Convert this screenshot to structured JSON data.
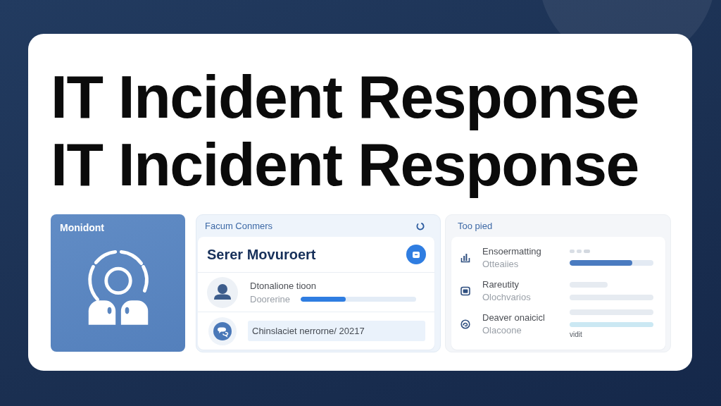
{
  "headline": [
    "IT Incident Response",
    "IT Incident Response"
  ],
  "left_panel": {
    "label": "Monidont"
  },
  "center_panel": {
    "header": "Facum Conmers",
    "title": "Serer Movuroert",
    "rows": [
      {
        "kind": "progress",
        "name": "Dtonalione tioon",
        "sub": "Doorerine",
        "level": 0.39
      },
      {
        "kind": "field",
        "value": "Chinslaciet nerrorne/ 20217"
      }
    ]
  },
  "right_panel": {
    "header": "Too pied",
    "rows": [
      {
        "name": "Ensoermatting",
        "sub": "Otteaiies",
        "aside": [
          {
            "kind": "dots"
          },
          {
            "kind": "meter",
            "level": 0.75
          }
        ]
      },
      {
        "name": "Rareutity",
        "sub": "Olochvarios",
        "aside": [
          {
            "kind": "stub"
          },
          {
            "kind": "line"
          }
        ]
      },
      {
        "name": "Deaver onaicicl",
        "sub": "Olacoone",
        "aside": [
          {
            "kind": "line"
          },
          {
            "kind": "accent"
          },
          {
            "kind": "caption",
            "text": "vidit"
          }
        ]
      }
    ]
  }
}
